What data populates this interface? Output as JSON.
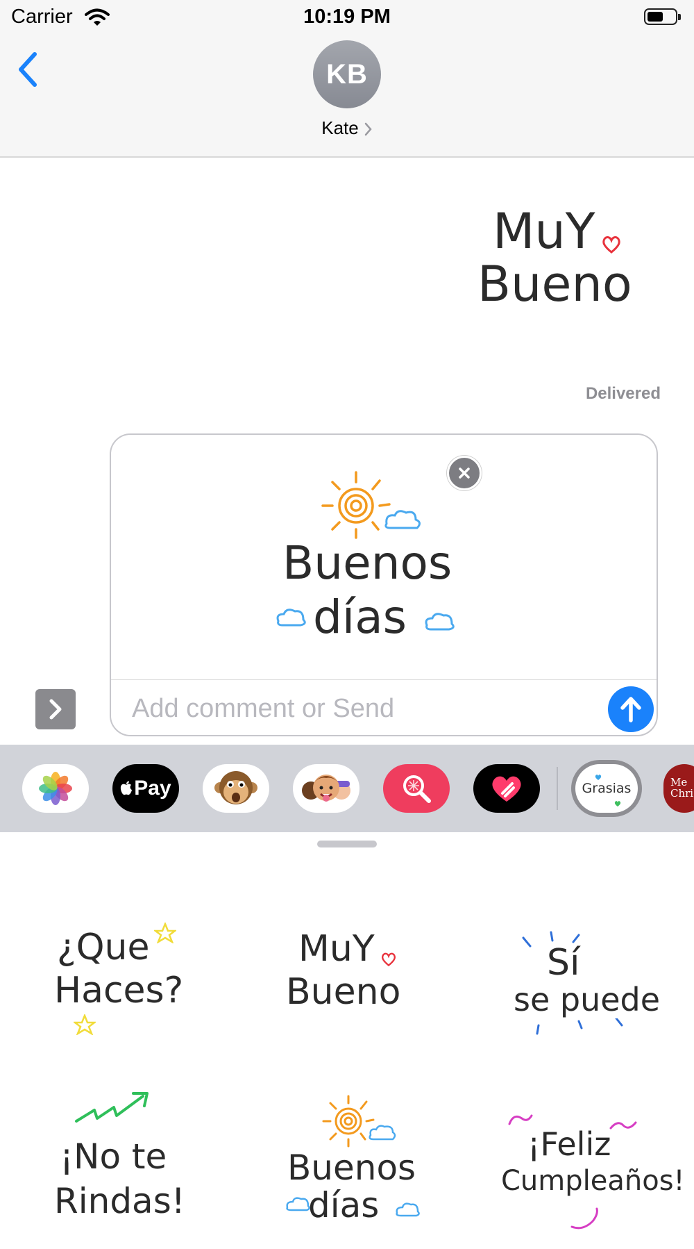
{
  "status_bar": {
    "carrier": "Carrier",
    "time": "10:19 PM",
    "wifi_icon": "wifi-icon",
    "battery_icon": "battery-icon"
  },
  "header": {
    "back_icon": "chevron-left-icon",
    "avatar_initials": "KB",
    "contact_name": "Kate"
  },
  "conversation": {
    "sent_sticker": {
      "line1": "MuY",
      "line2": "Bueno"
    },
    "delivered_label": "Delivered"
  },
  "compose": {
    "expand_icon": "chevron-right-icon",
    "attached_sticker": {
      "line1": "Buenos",
      "line2": "días"
    },
    "remove_icon": "close-icon",
    "placeholder": "Add comment or Send",
    "send_icon": "arrow-up-icon"
  },
  "app_strip": {
    "apps": [
      {
        "name": "photos-app-icon"
      },
      {
        "name": "apple-pay-app-icon",
        "label": "Pay"
      },
      {
        "name": "animoji-app-icon"
      },
      {
        "name": "memoji-app-icon"
      },
      {
        "name": "image-search-app-icon"
      },
      {
        "name": "digital-touch-app-icon"
      },
      {
        "name": "sticker-pack-app-icon",
        "label": "Grasias"
      },
      {
        "name": "christmas-sticker-app-icon",
        "label": "Me Chri"
      }
    ]
  },
  "drawer": {
    "stickers": [
      {
        "line1": "¿Que",
        "line2": "Haces?"
      },
      {
        "line1": "MuY",
        "line2": "Bueno"
      },
      {
        "line1": "Sí",
        "line2": "se puede"
      },
      {
        "line1": "¡No te",
        "line2": "Rindas!"
      },
      {
        "line1": "Buenos",
        "line2": "días"
      },
      {
        "line1": "¡Feliz",
        "line2": "Cumpleaños!"
      }
    ]
  },
  "colors": {
    "accent_blue": "#1a82fb",
    "heart_red": "#e8323c",
    "sun_orange": "#f39a1e",
    "cloud_blue": "#4aa9ef",
    "arrow_green": "#2fbf5a",
    "party_magenta": "#d63ec3",
    "star_yellow": "#f1dc3a"
  }
}
